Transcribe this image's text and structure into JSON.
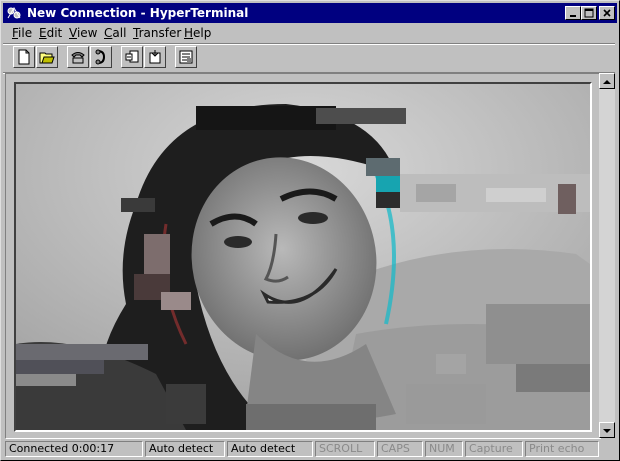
{
  "window": {
    "title": "New Connection - HyperTerminal",
    "controls": [
      "minimize-icon",
      "maximize-icon",
      "close-icon"
    ]
  },
  "menu": {
    "items": [
      {
        "label": "File",
        "accel": "F"
      },
      {
        "label": "Edit",
        "accel": "E"
      },
      {
        "label": "View",
        "accel": "V"
      },
      {
        "label": "Call",
        "accel": "C"
      },
      {
        "label": "Transfer",
        "accel": "T"
      },
      {
        "label": "Help",
        "accel": "H"
      }
    ]
  },
  "toolbar": {
    "buttons": [
      "new-icon",
      "open-icon",
      "connect-icon",
      "disconnect-icon",
      "send-icon",
      "receive-icon",
      "properties-icon"
    ]
  },
  "terminal": {
    "content": "glitched black-and-white photo"
  },
  "status": {
    "connected": "Connected 0:00:17",
    "detect1": "Auto detect",
    "detect2": "Auto detect",
    "scroll": "SCROLL",
    "caps": "CAPS",
    "num": "NUM",
    "capture": "Capture",
    "print_echo": "Print echo"
  }
}
